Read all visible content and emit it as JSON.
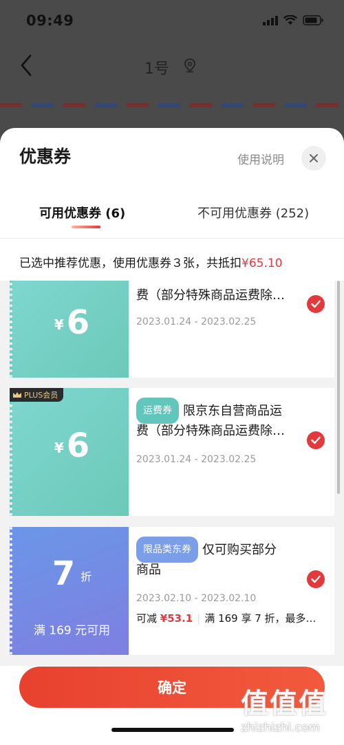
{
  "status_bar": {
    "time": "09:49"
  },
  "background_page": {
    "title": "1号"
  },
  "sheet": {
    "title": "优惠券",
    "usage_link": "使用说明",
    "tabs": [
      {
        "label": "可用优惠券 (6)",
        "active": true
      },
      {
        "label": "不可用优惠券 (252)",
        "active": false
      }
    ],
    "summary_prefix": "已选中推荐优惠，使用优惠券３张，共抵扣",
    "summary_amount": "¥65.10",
    "coupons": [
      {
        "currency": "¥",
        "amount": "6",
        "desc_line1": "费（部分特殊商品运费除…",
        "date": "2023.01.24 - 2023.02.25",
        "selected": true
      },
      {
        "badge": "PLUS会员",
        "currency": "¥",
        "amount": "6",
        "tag": "运费券",
        "desc_line1": "限京东自营商品运",
        "desc_line2": "费（部分特殊商品运费除…",
        "date": "2023.01.24 - 2023.02.25",
        "selected": true
      },
      {
        "amount": "7",
        "unit": "折",
        "condition": "满 169 元可用",
        "tag": "限品类东券",
        "desc_line1": "仅可购买部分",
        "desc_line2": "商品",
        "date": "2023.02.10 - 2023.02.10",
        "saving_label": "可减",
        "saving_amount": "¥53.1",
        "saving_rule": "满 169 享 7 折，最多…",
        "selected": true
      }
    ],
    "confirm_label": "确定"
  },
  "watermark": {
    "logo": "值值值",
    "url": "zhizhizhi.com"
  },
  "colors": {
    "accent": "#e4393c",
    "teal": "#6cc9b8",
    "blue": "#7a9ee8"
  }
}
